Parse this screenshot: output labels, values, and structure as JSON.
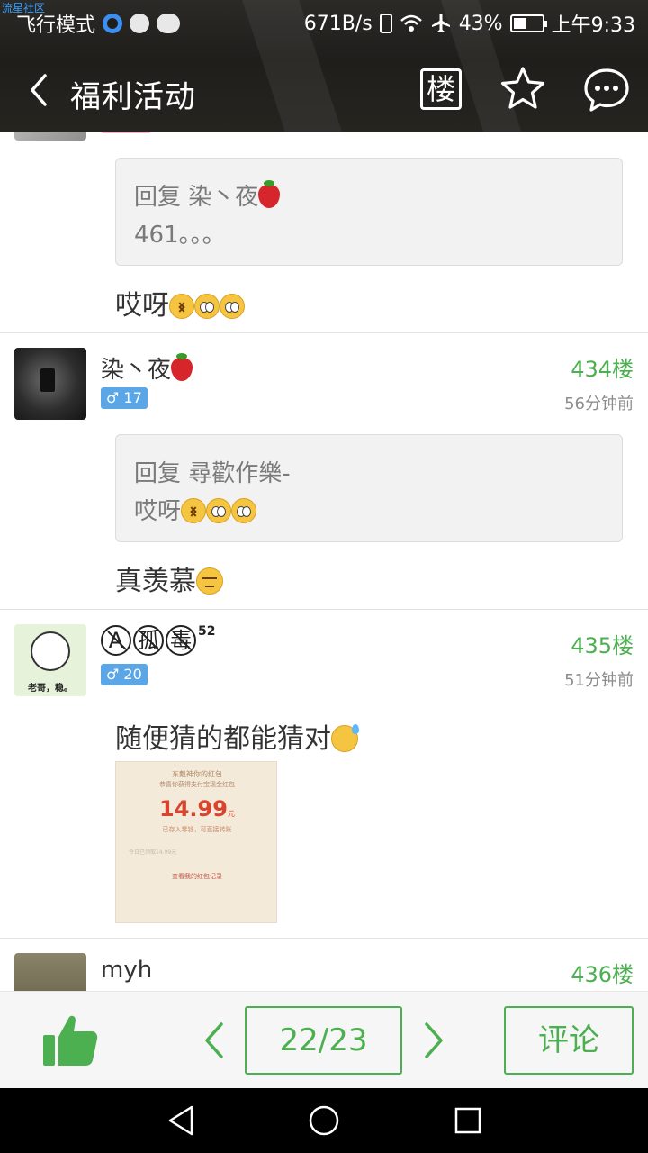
{
  "status_bar": {
    "watermark": "流星社区",
    "carrier": "飞行模式",
    "speed": "671B/s",
    "battery": "43%",
    "time": "上午9:33"
  },
  "header": {
    "title": "福利活动",
    "floor_button": "楼"
  },
  "partial_post": {
    "quote_line1": "回复 染丶夜",
    "quote_line2": "461。。。",
    "body": "哎呀"
  },
  "posts": [
    {
      "username": "染丶夜",
      "gender_badge": "♂ 17",
      "floor": "434楼",
      "time": "56分钟前",
      "quote_line1": "回复 尋歡作樂-",
      "quote_line2": "哎呀",
      "body": "真羡慕"
    },
    {
      "username_chars": [
        "A",
        "孤",
        "毒"
      ],
      "username_sup": "52",
      "gender_badge": "♂ 20",
      "floor": "435楼",
      "time": "51分钟前",
      "avatar_caption": "老哥，稳。",
      "body": "随便猜的都能猜对",
      "redpack": {
        "line1": "东戴神你的红包",
        "line2": "恭喜你获得支付宝现金红包",
        "amount": "14.99",
        "unit": "元",
        "line3": "已存入零钱，可直接转账",
        "line4": "今日已领取14.99元",
        "line5": "查看我的红包记录"
      }
    },
    {
      "username": "myh",
      "floor": "436楼"
    }
  ],
  "bottom_bar": {
    "page": "22/23",
    "comment": "评论"
  },
  "colors": {
    "accent_green": "#4caf50",
    "badge_blue": "#5aa6e6",
    "header_bg": "#22211e"
  }
}
